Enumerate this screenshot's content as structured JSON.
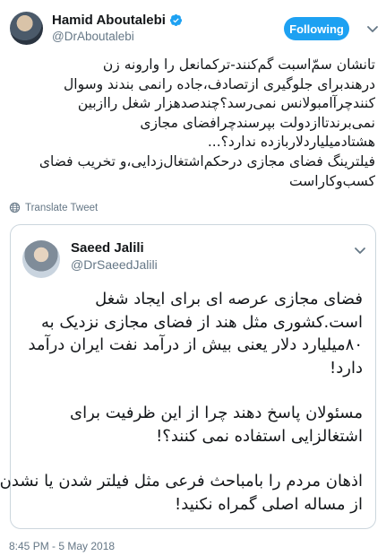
{
  "tweet": {
    "author": {
      "name": "Hamid Aboutalebi",
      "handle": "@DrAboutalebi",
      "verified": true
    },
    "follow_label": "Following",
    "text_lines": [
      "تانشان سمّ‌اسبت گم‌کنند-ترکمانعل را وارونه زن",
      "درهندبرای جلوگیری ازتصادف،جاده رانمی بندند وسوال",
      "کنندچرآامبولانس نمی‌رسد؟چندصدهزار شغل راازبین",
      "نمی‌برندتاازدولت بپرسندچرافضای مجازی",
      "هشتادمیلیاردلاربازده ندارد؟...",
      "فیلترینگ فضای مجازی درحکم‌اشتغال‌زدایی،و تخریب فضای",
      "کسب‌وکاراست"
    ],
    "translate_label": "Translate Tweet",
    "timestamp": "8:45 PM - 5 May 2018"
  },
  "quoted": {
    "author": {
      "name": "Saeed Jalili",
      "handle": "@DrSaeedJalili"
    },
    "paragraphs": [
      [
        "فضای مجازی عرصه ای برای ایجاد شغل",
        "است.کشوری مثل هند از فضای مجازی نزدیک به",
        "۸۰میلیارد دلار یعنی بیش از درآمد نفت ایران درآمد",
        "دارد!"
      ],
      [
        "مسئولان پاسخ دهند چرا از این ظرفیت برای",
        "اشتغالزایی استفاده نمی کنند؟!"
      ],
      [
        "اذهان مردم را بامباحث فرعی مثل فیلتر شدن یا نشدن،",
        "از مساله اصلی گمراه نکنید!"
      ]
    ]
  },
  "icons": {
    "verified": "verified-badge-icon",
    "caret": "chevron-down-icon",
    "translate": "globe-icon"
  },
  "colors": {
    "accent": "#1da1f2",
    "secondary_text": "#657786",
    "border": "#ccd6dd"
  }
}
